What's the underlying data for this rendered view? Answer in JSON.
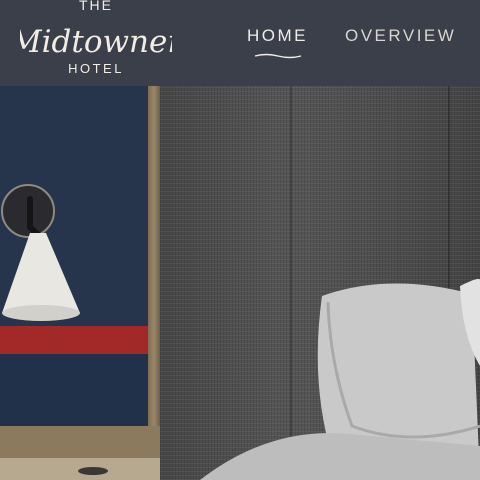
{
  "brand": {
    "the": "THE",
    "name": "Midtowner",
    "hotel": "HOTEL"
  },
  "nav": {
    "home": "HOME",
    "overview": "OVERVIEW",
    "active": "HOME"
  },
  "colors": {
    "header_bg": "#3a3f4a",
    "logo_text": "#f2ede4",
    "wall_blue": "#26354b",
    "accent_red": "#a32929",
    "headboard_gray": "#4b4b4b"
  }
}
